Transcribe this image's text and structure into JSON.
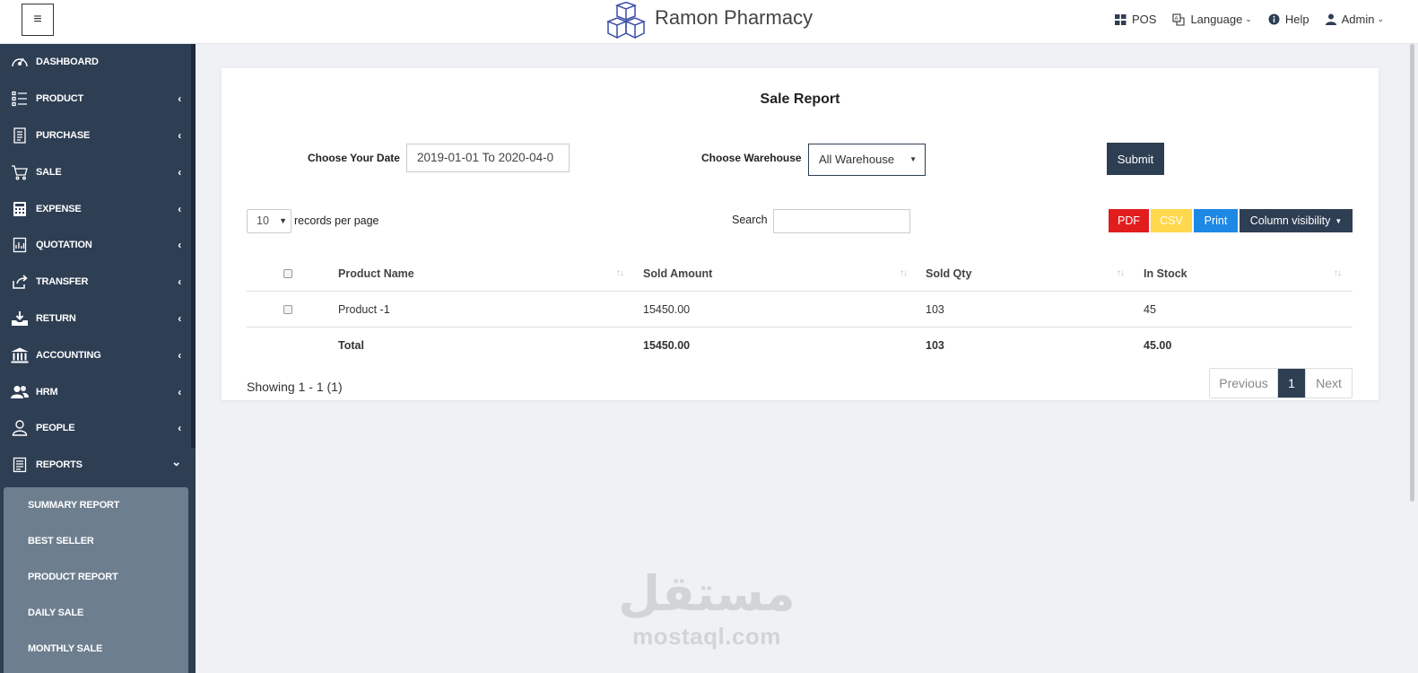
{
  "header": {
    "brand": "Ramon Pharmacy",
    "pos_label": "POS",
    "language_label": "Language",
    "help_label": "Help",
    "admin_label": "Admin"
  },
  "sidebar": {
    "items": [
      {
        "label": "DASHBOARD",
        "icon": "dashboard-icon",
        "has_children": false
      },
      {
        "label": "PRODUCT",
        "icon": "list-icon",
        "has_children": true
      },
      {
        "label": "PURCHASE",
        "icon": "receipt-icon",
        "has_children": true
      },
      {
        "label": "SALE",
        "icon": "cart-icon",
        "has_children": true
      },
      {
        "label": "EXPENSE",
        "icon": "calculator-icon",
        "has_children": true
      },
      {
        "label": "QUOTATION",
        "icon": "report-icon",
        "has_children": true
      },
      {
        "label": "TRANSFER",
        "icon": "share-icon",
        "has_children": true
      },
      {
        "label": "RETURN",
        "icon": "download-tray-icon",
        "has_children": true
      },
      {
        "label": "ACCOUNTING",
        "icon": "bank-icon",
        "has_children": true
      },
      {
        "label": "HRM",
        "icon": "users-icon",
        "has_children": true
      },
      {
        "label": "PEOPLE",
        "icon": "user-icon",
        "has_children": true
      },
      {
        "label": "REPORTS",
        "icon": "document-icon",
        "has_children": true,
        "expanded": true
      }
    ],
    "reports_submenu": [
      "SUMMARY REPORT",
      "BEST SELLER",
      "PRODUCT REPORT",
      "DAILY SALE",
      "MONTHLY SALE"
    ]
  },
  "report": {
    "title": "Sale Report",
    "date_label": "Choose Your Date",
    "date_value": "2019-01-01 To 2020-04-0",
    "warehouse_label": "Choose Warehouse",
    "warehouse_value": "All Warehouse",
    "submit_label": "Submit",
    "per_page_value": "10",
    "per_page_label": "records per page",
    "search_label": "Search",
    "buttons": {
      "pdf": "PDF",
      "csv": "CSV",
      "print": "Print",
      "column_visibility": "Column visibility"
    },
    "columns": [
      "Product Name",
      "Sold Amount",
      "Sold Qty",
      "In Stock"
    ],
    "rows": [
      {
        "product": "Product -1",
        "sold_amount": "15450.00",
        "sold_qty": "103",
        "in_stock": "45"
      }
    ],
    "total": {
      "label": "Total",
      "sold_amount": "15450.00",
      "sold_qty": "103",
      "in_stock": "45.00"
    },
    "showing": "Showing 1 - 1 (1)",
    "pagination": {
      "previous": "Previous",
      "current": "1",
      "next": "Next"
    }
  },
  "watermark": {
    "arabic": "مستقل",
    "latin": "mostaql.com"
  },
  "colors": {
    "sidebar": "#2e3e53",
    "submenu": "#6d7e8f",
    "pdf": "#e11d1d",
    "csv": "#ffd84d",
    "print": "#1e88e5"
  }
}
